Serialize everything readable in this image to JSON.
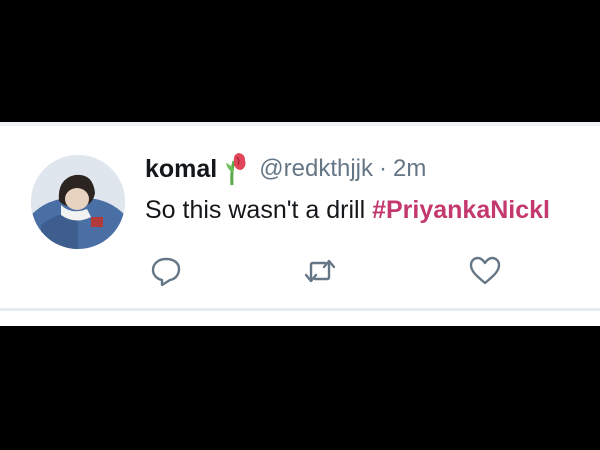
{
  "tweet": {
    "display_name": "komal",
    "name_emoji": "wilted-rose-icon",
    "handle": "@redkthjjk",
    "separator": "·",
    "time": "2m",
    "text": "So this wasn't a drill ",
    "hashtag": "#PriyankaNickl"
  },
  "actions": {
    "reply": "reply-icon",
    "retweet": "retweet-icon",
    "like": "heart-icon"
  },
  "colors": {
    "hashtag": "#c3396e",
    "meta_text": "#657786",
    "icon": "#657786",
    "text": "#14171a"
  }
}
